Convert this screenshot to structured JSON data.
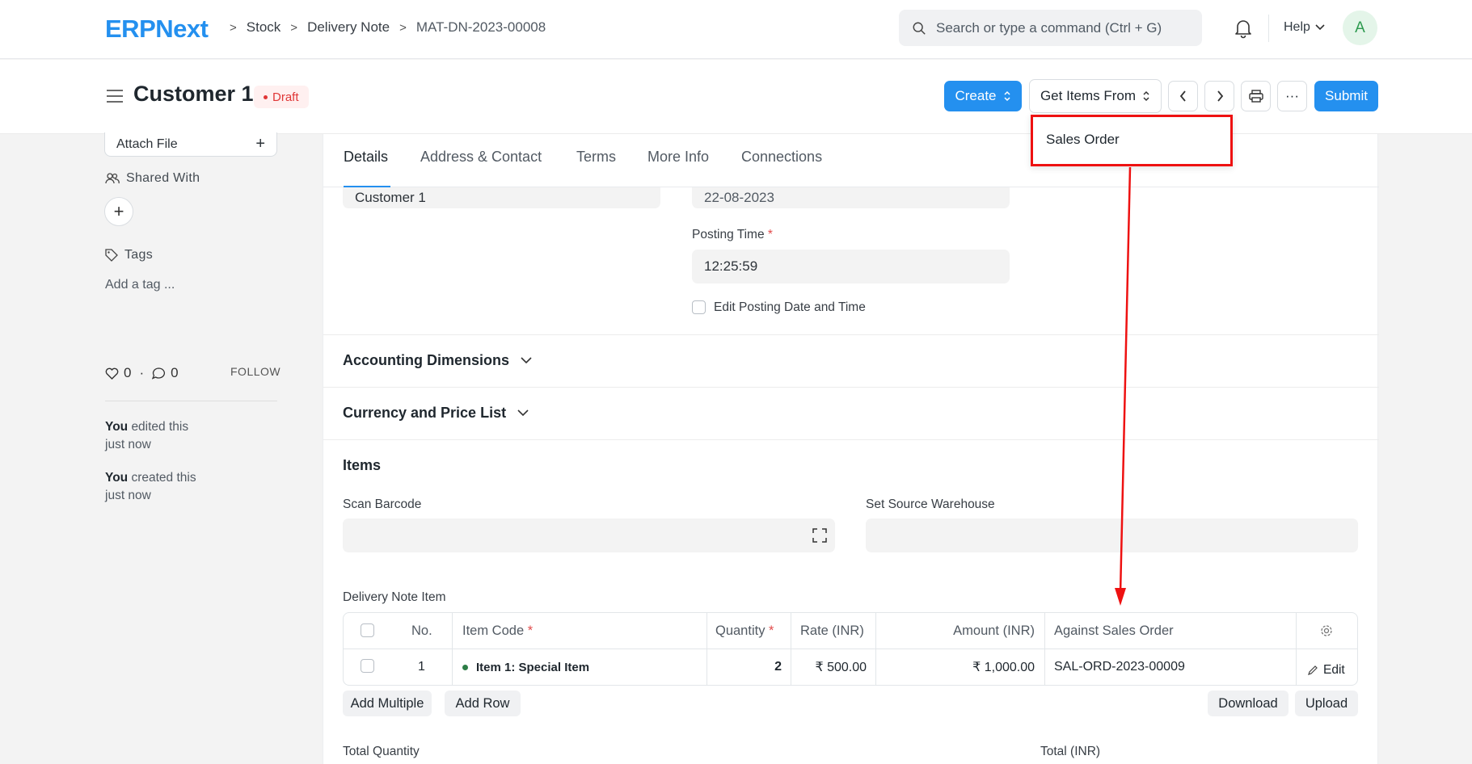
{
  "header": {
    "logo": "ERPNext",
    "breadcrumbs": [
      "Stock",
      "Delivery Note",
      "MAT-DN-2023-00008"
    ],
    "search_placeholder": "Search or type a command (Ctrl + G)",
    "help_label": "Help",
    "avatar_initial": "A"
  },
  "page": {
    "title": "Customer 1",
    "status": "Draft",
    "actions": {
      "create": "Create",
      "get_items": "Get Items From",
      "print_icon": "printer-icon",
      "more": "···",
      "submit": "Submit"
    },
    "get_items_menu": [
      "Sales Order"
    ]
  },
  "sidebar": {
    "attach_file": "Attach File",
    "shared_with": "Shared With",
    "tags": "Tags",
    "add_tag": "Add a tag ...",
    "likes": "0",
    "comments": "0",
    "follow": "FOLLOW",
    "activity": [
      {
        "who": "You",
        "action": "edited this",
        "when": "just now"
      },
      {
        "who": "You",
        "action": "created this",
        "when": "just now"
      }
    ]
  },
  "tabs": [
    "Details",
    "Address & Contact",
    "Terms",
    "More Info",
    "Connections"
  ],
  "form": {
    "customer_value": "Customer 1",
    "posting_date_value": "22-08-2023",
    "posting_time_label": "Posting Time",
    "posting_time_value": "12:25:59",
    "edit_posting_label": "Edit Posting Date and Time",
    "sections": {
      "accounting": "Accounting Dimensions",
      "currency": "Currency and Price List",
      "items": "Items"
    },
    "scan_barcode_label": "Scan Barcode",
    "source_warehouse_label": "Set Source Warehouse",
    "table_label": "Delivery Note Item",
    "total_quantity_label": "Total Quantity",
    "total_label": "Total (INR)"
  },
  "items_table": {
    "columns": [
      "No.",
      "Item Code",
      "Quantity",
      "Rate (INR)",
      "Amount (INR)",
      "Against Sales Order"
    ],
    "rows": [
      {
        "no": "1",
        "item_code": "Item 1: Special Item",
        "qty": "2",
        "rate": "₹ 500.00",
        "amount": "₹ 1,000.00",
        "against_so": "SAL-ORD-2023-00009",
        "edit": "Edit"
      }
    ],
    "buttons": {
      "add_multiple": "Add Multiple",
      "add_row": "Add Row",
      "download": "Download",
      "upload": "Upload"
    }
  },
  "colors": {
    "primary": "#2490ef",
    "draft": "#e03636",
    "highlight": "#e11111"
  }
}
